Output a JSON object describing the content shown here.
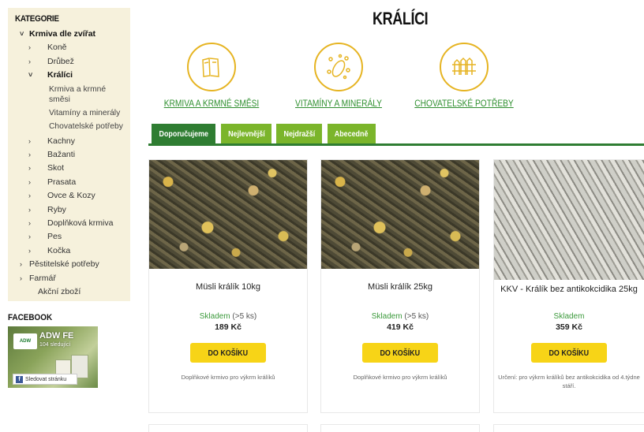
{
  "sidebar": {
    "title": "KATEGORIE",
    "top_category": "Krmiva dle zvířat",
    "animals": [
      "Koně",
      "Drůbež",
      "Králíci"
    ],
    "rabbit_sub": [
      "Krmiva a krmné směsi",
      "Vitamíny a minerály",
      "Chovatelské potřeby"
    ],
    "animals_after": [
      "Kachny",
      "Bažanti",
      "Skot",
      "Prasata",
      "Ovce & Kozy",
      "Ryby",
      "Doplňková krmiva",
      "Pes",
      "Kočka"
    ],
    "other_categories": [
      "Pěstitelské potřeby",
      "Farmář"
    ],
    "sale": "Akční zboží"
  },
  "facebook": {
    "title": "FACEBOOK",
    "page_name": "ADW FE",
    "followers": "104 sledující",
    "follow_button": "Sledovat stránku",
    "logo_text": "ADW"
  },
  "page": {
    "title": "KRÁLÍCI"
  },
  "subcategories": [
    {
      "label": "KRMIVA A KRMNÉ SMĚSI",
      "icon": "feed-bags-icon"
    },
    {
      "label": "VITAMÍNY A MINERÁLY",
      "icon": "seeds-vitamins-icon"
    },
    {
      "label": "CHOVATELSKÉ POTŘEBY",
      "icon": "fence-icon"
    }
  ],
  "tabs": [
    "Doporučujeme",
    "Nejlevnější",
    "Nejdražší",
    "Abecedně"
  ],
  "active_tab": "Doporučujeme",
  "products": [
    {
      "name": "Müsli králík 10kg",
      "stock": "Skladem",
      "stock_extra": "(>5 ks)",
      "price": "189 Kč",
      "button": "DO KOŠÍKU",
      "desc": "Doplňkové krmivo pro výkrm králíků"
    },
    {
      "name": "Müsli králík 25kg",
      "stock": "Skladem",
      "stock_extra": "(>5 ks)",
      "price": "419 Kč",
      "button": "DO KOŠÍKU",
      "desc": "Doplňkové krmivo pro výkrm králíků"
    },
    {
      "name": "KKV - Králík bez antikokcidika 25kg",
      "stock": "Skladem",
      "stock_extra": "",
      "price": "359 Kč",
      "button": "DO KOŠÍKU",
      "desc": "Určení: pro výkrm králíků bez antikokcidika od 4.týdne stáří."
    }
  ],
  "colors": {
    "accent_green": "#2f7d32",
    "tab_green": "#7bb52b",
    "button_yellow": "#f7d417",
    "icon_gold": "#e6b422",
    "link_green": "#2f8f2f",
    "sidebar_bg": "#f6f1dc"
  }
}
